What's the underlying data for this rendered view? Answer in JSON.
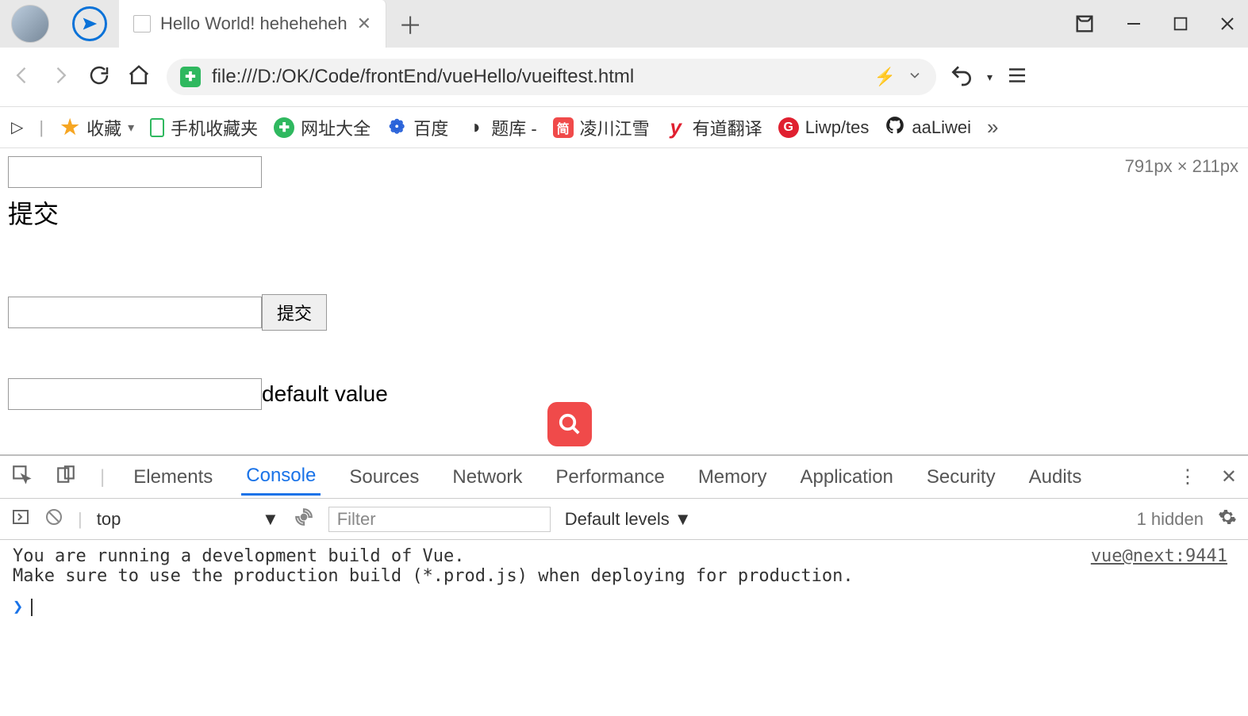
{
  "titlebar": {
    "tab_title": "Hello World! heheheheh",
    "close_glyph": "✕",
    "newtab_glyph": "＋"
  },
  "addrbar": {
    "url": "file:///D:/OK/Code/frontEnd/vueHello/vueiftest.html",
    "shield_glyph": "✚"
  },
  "bookmarks": {
    "sidebar_glyph": "▷",
    "items": [
      {
        "label": "收藏",
        "color": "#f6a623",
        "glyph": "★"
      },
      {
        "label": "手机收藏夹",
        "color": "#2fb85f",
        "glyph": "▢"
      },
      {
        "label": "网址大全",
        "color": "#2fb85f",
        "glyph": "✚"
      },
      {
        "label": "百度",
        "color": "#2962d9",
        "glyph": "❁"
      },
      {
        "label": "题库 -",
        "color": "#666",
        "glyph": "◑"
      },
      {
        "label": "凌川江雪",
        "color": "#f04a4a",
        "glyph": "简"
      },
      {
        "label": "有道翻译",
        "color": "#e02030",
        "glyph": "y"
      },
      {
        "label": "Liwp/tes",
        "color": "#e02030",
        "glyph": "G"
      },
      {
        "label": "aaLiwei",
        "color": "#222",
        "glyph": ""
      }
    ],
    "dropdown_glyph": "▾",
    "more_glyph": "»"
  },
  "page": {
    "dimensions": "791px × 211px",
    "submit_text_1": "提交",
    "submit_button_2": "提交",
    "output_text_3": "default value"
  },
  "devtools": {
    "tabs": [
      "Elements",
      "Console",
      "Sources",
      "Network",
      "Performance",
      "Memory",
      "Application",
      "Security",
      "Audits"
    ],
    "active_tab_index": 1,
    "context": "top",
    "context_arrow": "▼",
    "filter_placeholder": "Filter",
    "levels": "Default levels ▼",
    "hidden_text": "1 hidden",
    "message_line1": "You are running a development build of Vue.",
    "message_line2": "Make sure to use the production build (*.prod.js) when deploying for production.",
    "source_link": "vue@next:9441",
    "prompt_arrow": "❯"
  }
}
